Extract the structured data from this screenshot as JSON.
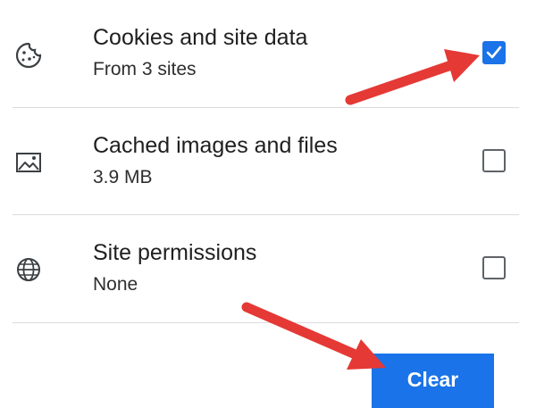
{
  "options": [
    {
      "title": "Cookies and site data",
      "subtitle": "From 3 sites",
      "checked": true,
      "icon": "cookie-icon"
    },
    {
      "title": "Cached images and files",
      "subtitle": "3.9 MB",
      "checked": false,
      "icon": "image-icon"
    },
    {
      "title": "Site permissions",
      "subtitle": "None",
      "checked": false,
      "icon": "globe-icon"
    }
  ],
  "clear_button": {
    "label": "Clear"
  },
  "colors": {
    "accent": "#1a73e8",
    "annotation_arrow": "#e53935"
  }
}
